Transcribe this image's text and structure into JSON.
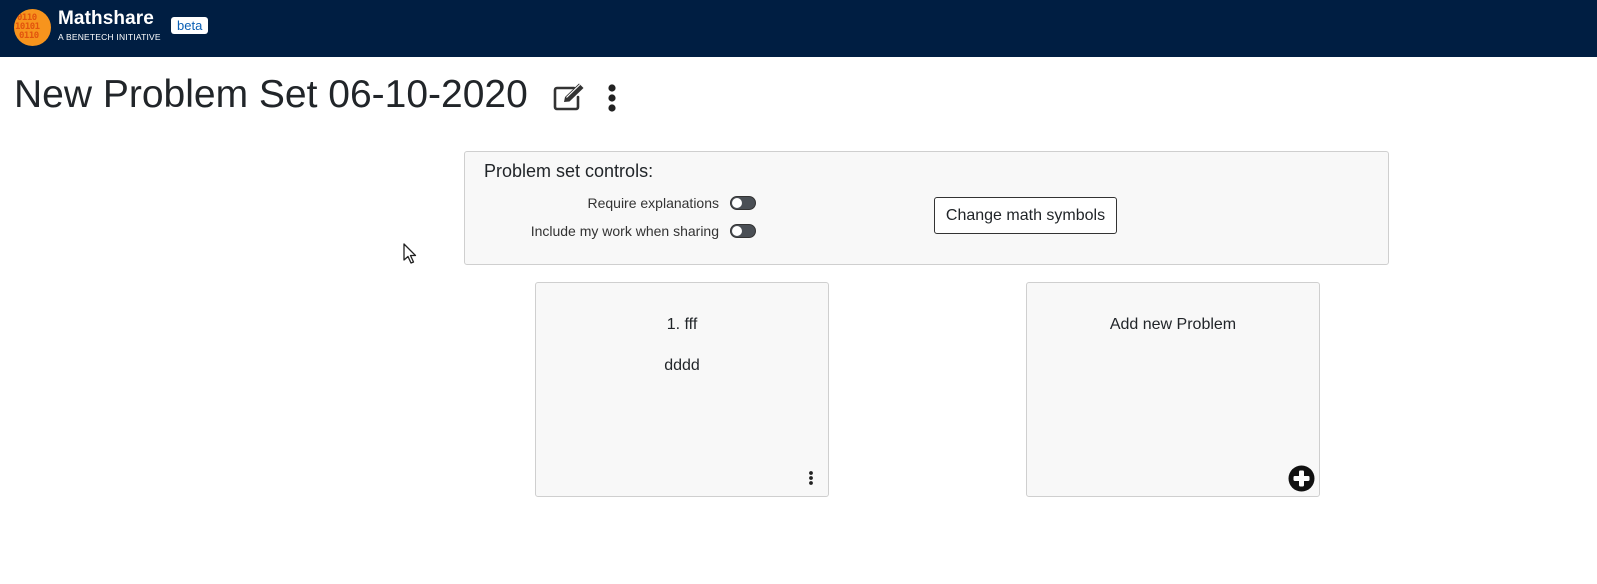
{
  "navbar": {
    "brand": "Mathshare",
    "subtitle": "A BENETECH INITIATIVE",
    "badge": "beta",
    "logo_digits": [
      "0110",
      "10101",
      "0110"
    ],
    "background_color": "#001e42",
    "logo_color": "#f7941d"
  },
  "page": {
    "title": "New Problem Set 06-10-2020",
    "edit_icon": "pencil-square-icon",
    "menu_icon": "vertical-ellipsis-icon"
  },
  "controls": {
    "heading": "Problem set controls:",
    "require_explanations_label": "Require explanations",
    "require_explanations_on": false,
    "include_work_label": "Include my work when sharing",
    "include_work_on": false,
    "change_symbols_button": "Change math symbols"
  },
  "problems": [
    {
      "title": "1. fff",
      "text": "dddd",
      "menu_icon": "vertical-ellipsis-icon"
    }
  ],
  "add_card": {
    "label": "Add new Problem",
    "icon": "plus-circle-icon"
  }
}
